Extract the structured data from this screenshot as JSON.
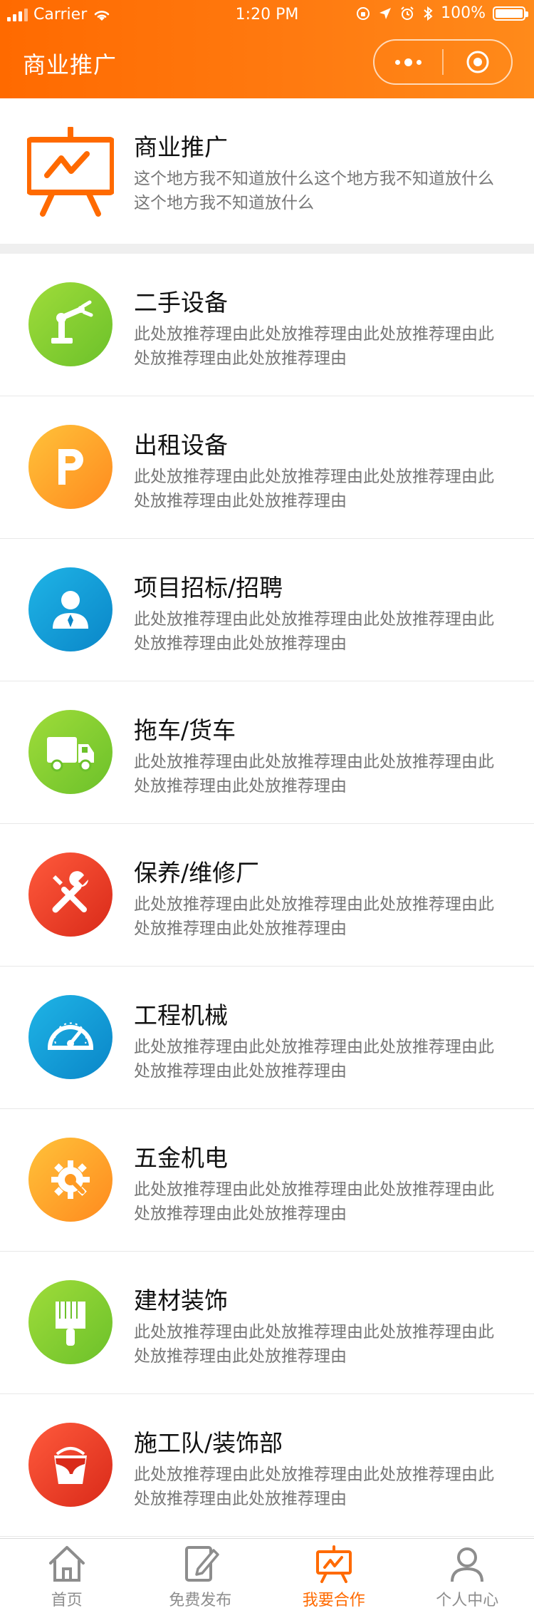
{
  "status_bar": {
    "carrier": "Carrier",
    "time": "1:20 PM",
    "battery": "100%"
  },
  "nav": {
    "title": "商业推广"
  },
  "banner": {
    "title": "商业推广",
    "description": "这个地方我不知道放什么这个地方我不知道放什么这个地方我不知道放什么",
    "icon": "presentation-chart-icon"
  },
  "list": {
    "items": [
      {
        "title": "二手设备",
        "description": "此处放推荐理由此处放推荐理由此处放推荐理由此处放推荐理由此处放推荐理由",
        "icon": "robot-arm-icon",
        "color": "#7cc92f"
      },
      {
        "title": "出租设备",
        "description": "此处放推荐理由此处放推荐理由此处放推荐理由此处放推荐理由此处放推荐理由",
        "icon": "parking-p-icon",
        "color": "#ffa52a"
      },
      {
        "title": "项目招标/招聘",
        "description": "此处放推荐理由此处放推荐理由此处放推荐理由此处放推荐理由此处放推荐理由",
        "icon": "person-icon",
        "color": "#1296d6"
      },
      {
        "title": "拖车/货车",
        "description": "此处放推荐理由此处放推荐理由此处放推荐理由此处放推荐理由此处放推荐理由",
        "icon": "truck-icon",
        "color": "#7cc92f"
      },
      {
        "title": "保养/维修厂",
        "description": "此处放推荐理由此处放推荐理由此处放推荐理由此处放推荐理由此处放推荐理由",
        "icon": "wrench-screwdriver-icon",
        "color": "#e63a22"
      },
      {
        "title": "工程机械",
        "description": "此处放推荐理由此处放推荐理由此处放推荐理由此处放推荐理由此处放推荐理由",
        "icon": "speedometer-icon",
        "color": "#1296d6"
      },
      {
        "title": "五金机电",
        "description": "此处放推荐理由此处放推荐理由此处放推荐理由此处放推荐理由此处放推荐理由",
        "icon": "gear-wrench-icon",
        "color": "#ffa52a"
      },
      {
        "title": "建材装饰",
        "description": "此处放推荐理由此处放推荐理由此处放推荐理由此处放推荐理由此处放推荐理由",
        "icon": "paint-brush-icon",
        "color": "#7cc92f"
      },
      {
        "title": "施工队/装饰部",
        "description": "此处放推荐理由此处放推荐理由此处放推荐理由此处放推荐理由此处放推荐理由",
        "icon": "paint-bucket-icon",
        "color": "#e63a22"
      }
    ]
  },
  "tabbar": {
    "active_color": "#ff6a00",
    "inactive_color": "#8d8d8d",
    "tabs": [
      {
        "label": "首页",
        "icon": "home-icon"
      },
      {
        "label": "免费发布",
        "icon": "edit-icon"
      },
      {
        "label": "我要合作",
        "icon": "presentation-chart-icon",
        "active": true
      },
      {
        "label": "个人中心",
        "icon": "user-icon"
      }
    ]
  }
}
